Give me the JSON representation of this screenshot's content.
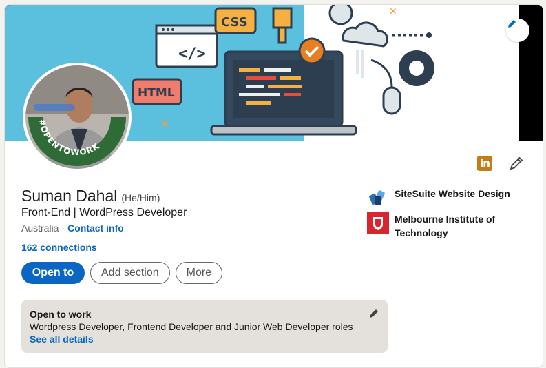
{
  "banner": {
    "labels": {
      "css": "CSS",
      "html": "HTML",
      "code": "</>"
    }
  },
  "avatar": {
    "frame_text": "#OPENTOWORK"
  },
  "profile": {
    "name": "Suman Dahal",
    "pronouns": "(He/Him)",
    "headline": "Front-End | WordPress Developer",
    "location": "Australia",
    "separator": "·",
    "contact_link": "Contact info",
    "connections": "162 connections"
  },
  "actions": {
    "open_to": "Open to",
    "add_section": "Add section",
    "more": "More"
  },
  "open_to_work": {
    "title": "Open to work",
    "description": "Wordpress Developer, Frontend Developer and Junior Web Developer roles",
    "link": "See all details"
  },
  "organizations": [
    {
      "name": "SiteSuite Website Design",
      "logo": "sitesuite-logo"
    },
    {
      "name": "Melbourne Institute of Technology",
      "logo": "mit-logo"
    }
  ],
  "colors": {
    "primary": "#0a66c2",
    "open_to_work_green": "#2f6b36",
    "banner_blue": "#5bc0de"
  }
}
